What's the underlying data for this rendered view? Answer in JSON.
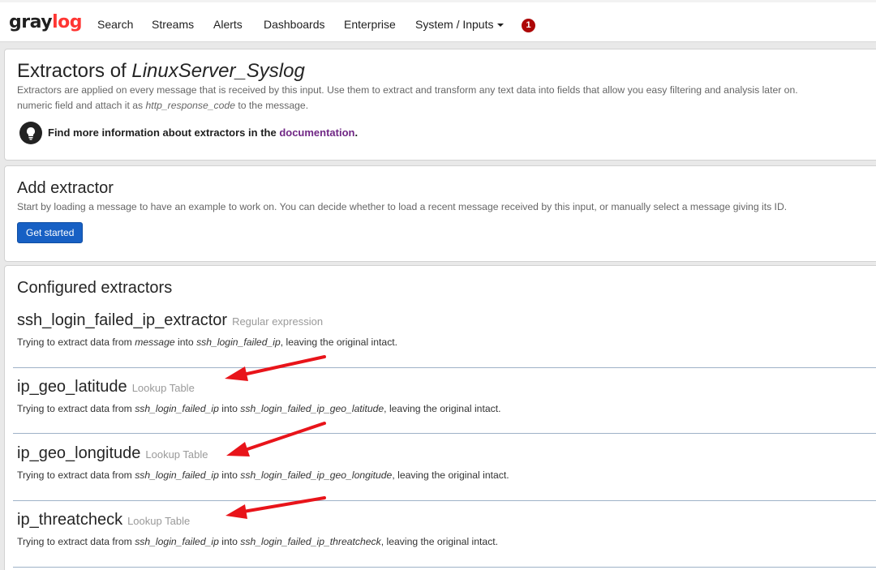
{
  "nav": {
    "logo_part1": "gray",
    "logo_part2": "log",
    "items": [
      "Search",
      "Streams",
      "Alerts",
      "Dashboards",
      "Enterprise",
      "System / Inputs"
    ],
    "notification_count": "1"
  },
  "header": {
    "title_prefix": "Extractors of ",
    "input_name": "LinuxServer_Syslog",
    "desc_line1": "Extractors are applied on every message that is received by this input. Use them to extract and transform any text data into fields that allow you easy filtering and analysis later on.",
    "desc_line2_prefix": "numeric field and attach it as ",
    "desc_line2_field": "http_response_code",
    "desc_line2_suffix": " to the message.",
    "info_text": "Find more information about extractors in the ",
    "info_link": "documentation",
    "info_end": "."
  },
  "add_extractor": {
    "heading": "Add extractor",
    "description": "Start by loading a message to have an example to work on. You can decide whether to load a recent message received by this input, or manually select a message giving its ID.",
    "button_label": "Get started"
  },
  "configured": {
    "heading": "Configured extractors",
    "desc_prefix": "Trying to extract data from ",
    "desc_middle": " into ",
    "desc_suffix": ", leaving the original intact.",
    "extractors": [
      {
        "name": "ssh_login_failed_ip_extractor",
        "type": "Regular expression",
        "source": "message",
        "target": "ssh_login_failed_ip"
      },
      {
        "name": "ip_geo_latitude",
        "type": "Lookup Table",
        "source": "ssh_login_failed_ip",
        "target": "ssh_login_failed_ip_geo_latitude"
      },
      {
        "name": "ip_geo_longitude",
        "type": "Lookup Table",
        "source": "ssh_login_failed_ip",
        "target": "ssh_login_failed_ip_geo_longitude"
      },
      {
        "name": "ip_threatcheck",
        "type": "Lookup Table",
        "source": "ssh_login_failed_ip",
        "target": "ssh_login_failed_ip_threatcheck"
      }
    ]
  },
  "colors": {
    "brand_red": "#ff3633",
    "primary_button": "#1760c4",
    "link_purple": "#702785",
    "badge_red": "#ad0707",
    "annotation_arrow": "#e8141a"
  }
}
